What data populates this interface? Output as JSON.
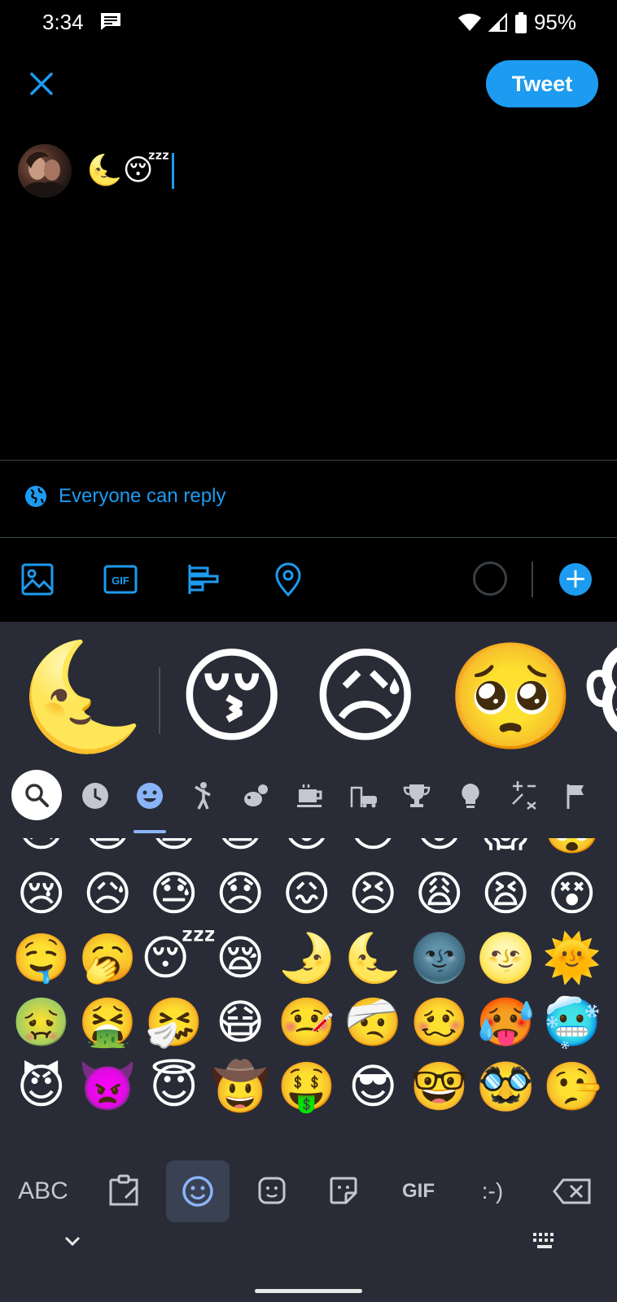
{
  "status_bar": {
    "time": "3:34",
    "battery": "95%"
  },
  "compose": {
    "tweet_button": "Tweet",
    "text": "🌜😴",
    "reply_setting": "Everyone can reply"
  },
  "colors": {
    "accent": "#1d9bf0",
    "keyboard_bg": "#292c36",
    "divider": "#38444d"
  },
  "keyboard": {
    "suggestions": [
      "🌜",
      "😚",
      "😥",
      "🥺",
      "🐵"
    ],
    "categories": [
      "search",
      "recent",
      "smileys",
      "people",
      "animals",
      "food",
      "travel",
      "activities",
      "objects",
      "symbols",
      "flags"
    ],
    "selected_category": "smileys",
    "emoji_rows": [
      [
        "😥",
        "😦",
        "😧",
        "😨",
        "😮",
        "😯",
        "😲",
        "😱",
        "🤯"
      ],
      [
        "😢",
        "😥",
        "😓",
        "😞",
        "😖",
        "😣",
        "😩",
        "😫",
        "😵"
      ],
      [
        "🤤",
        "🥱",
        "😴",
        "😪",
        "🌛",
        "🌜",
        "🌚",
        "🌝",
        "🌞"
      ],
      [
        "🤢",
        "🤮",
        "🤧",
        "😷",
        "🤒",
        "🤕",
        "🥴",
        "🥵",
        "🥶"
      ],
      [
        "😈",
        "👿",
        "😇",
        "🤠",
        "🤑",
        "😎",
        "🤓",
        "🥸",
        "🤥"
      ],
      [
        "🤡",
        "👻",
        "💩",
        "👽",
        "🤖",
        "🎃",
        "😺",
        "👹",
        "💀"
      ]
    ],
    "bottom_bar": {
      "abc": "ABC",
      "gif": "GIF",
      "emoticon": ":-)"
    }
  }
}
